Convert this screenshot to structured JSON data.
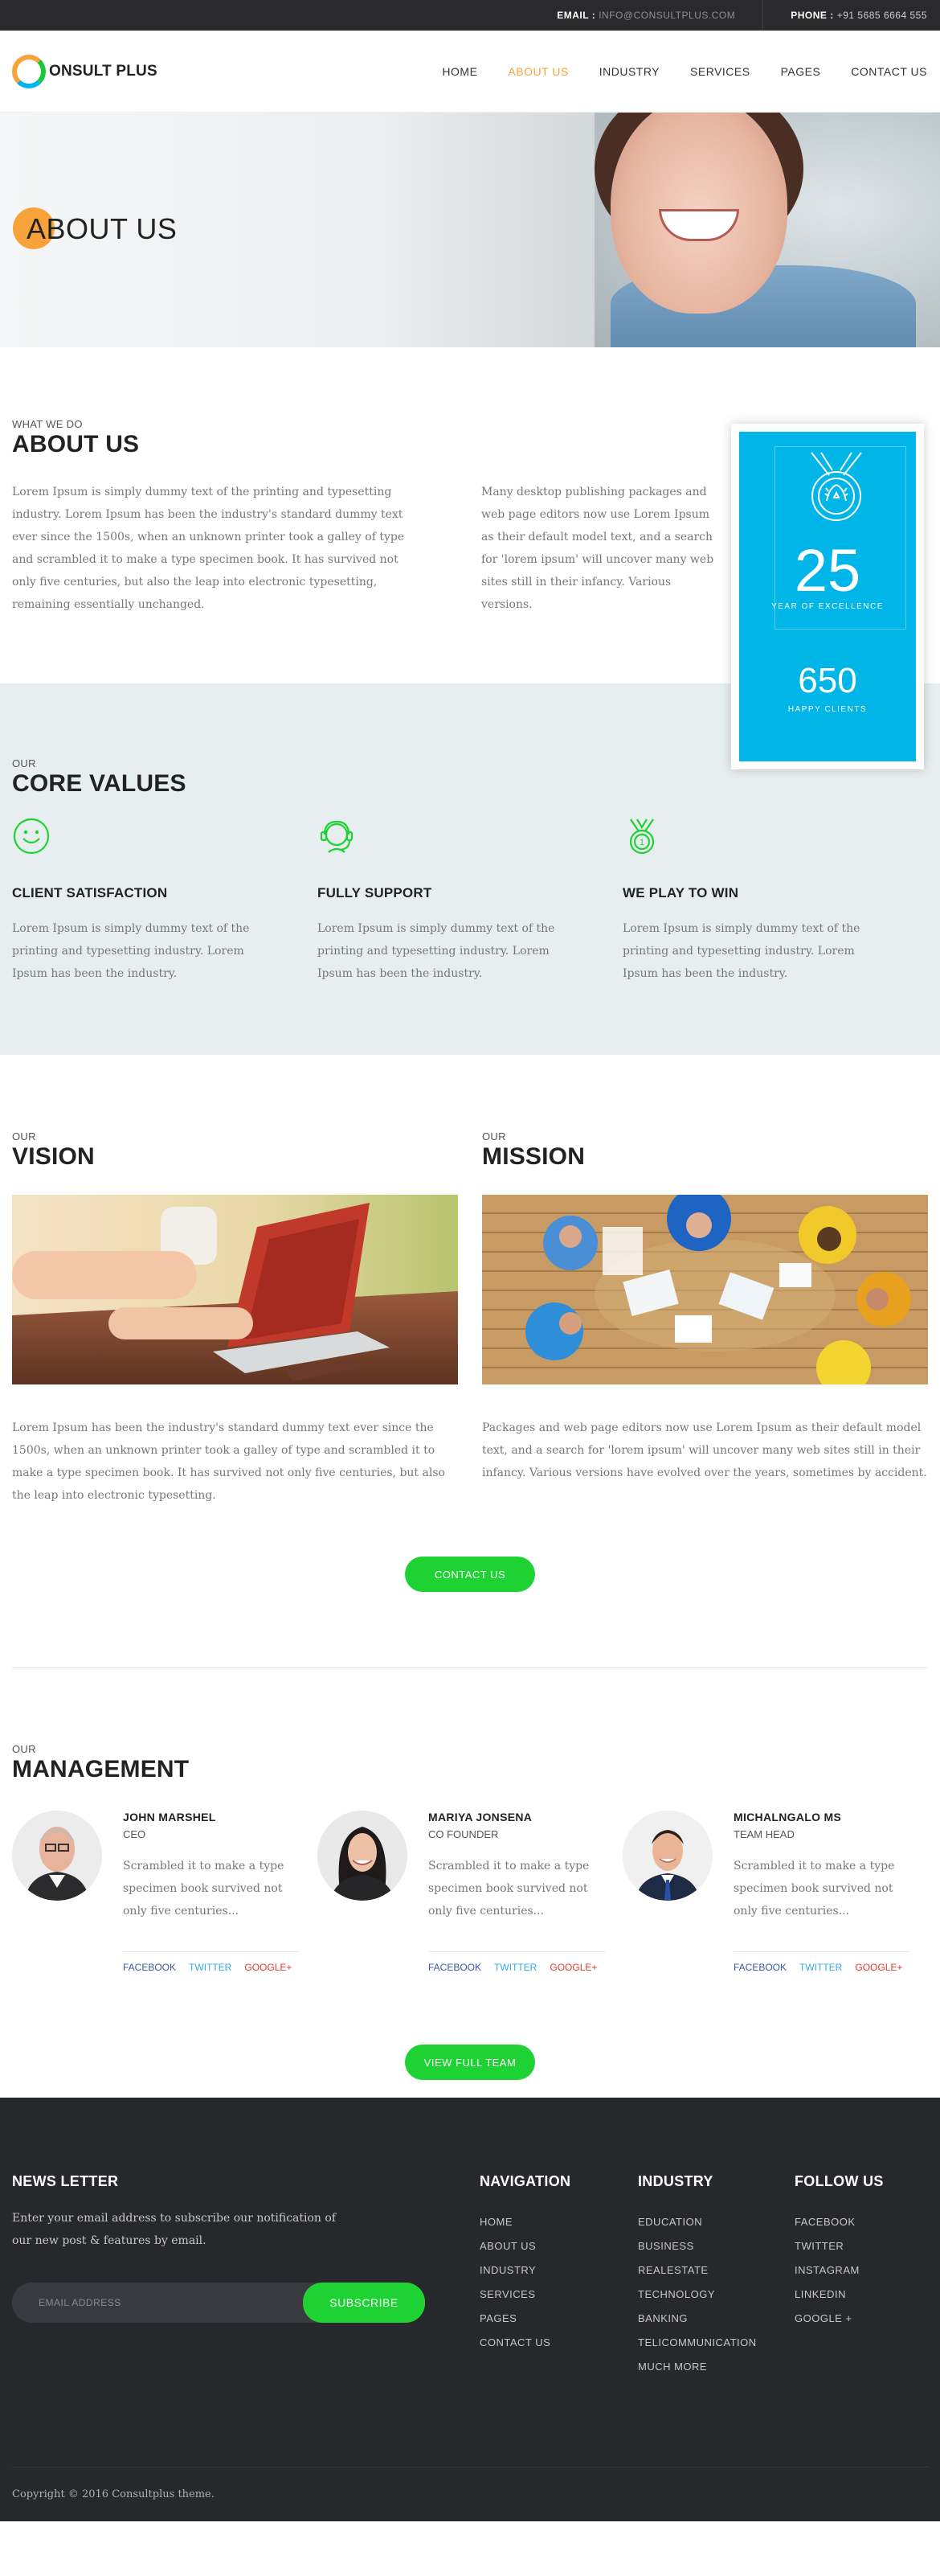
{
  "topbar": {
    "email_label": "EMAIL :",
    "email_value": "INFO@CONSULTPLUS.COM",
    "phone_label": "PHONE :",
    "phone_value": "+91 5685 6664 555"
  },
  "header": {
    "logo_text": "ONSULT PLUS",
    "nav": [
      {
        "label": "HOME"
      },
      {
        "label": "ABOUT US",
        "active": true
      },
      {
        "label": "INDUSTRY"
      },
      {
        "label": "SERVICES"
      },
      {
        "label": "PAGES"
      },
      {
        "label": "CONTACT US"
      }
    ],
    "accent_color": "#f7a23a"
  },
  "hero": {
    "title": "ABOUT US"
  },
  "about": {
    "eyebrow": "WHAT WE DO",
    "title": "ABOUT US",
    "col1": "Lorem Ipsum is simply dummy text of the printing and typesetting industry. Lorem Ipsum has been the industry's standard dummy text ever since the 1500s, when an unknown printer took a galley of type and scrambled it to make a type specimen book. It has survived not only five centuries, but also the leap into electronic typesetting, remaining essentially unchanged.",
    "col2": "Many desktop publishing packages and web page editors now use Lorem Ipsum as their default model text, and a search for 'lorem ipsum' will uncover many web sites still in their infancy. Various versions.",
    "stats": {
      "years_value": "25",
      "years_label": "YEAR OF EXCELLENCE",
      "clients_value": "650",
      "clients_label": "HAPPY CLIENTS",
      "card_color": "#00b5e8"
    }
  },
  "core": {
    "eyebrow": "OUR",
    "title": "CORE VALUES",
    "items": [
      {
        "icon": "smiley-icon",
        "title": "CLIENT SATISFACTION",
        "text": "Lorem Ipsum is simply dummy text of the printing and typesetting industry. Lorem Ipsum has been the industry."
      },
      {
        "icon": "support-headset-icon",
        "title": "FULLY SUPPORT",
        "text": "Lorem Ipsum is simply dummy text of the printing and typesetting industry. Lorem Ipsum has been the industry."
      },
      {
        "icon": "medal-icon",
        "title": "WE PLAY TO WIN",
        "text": "Lorem Ipsum is simply dummy text of the printing and typesetting industry. Lorem Ipsum has been the industry."
      }
    ],
    "icon_color": "#1fd233"
  },
  "vision": {
    "eyebrow": "OUR",
    "title": "VISION",
    "text": "Lorem Ipsum has been the industry's standard dummy text ever since the 1500s, when an unknown printer took a galley of type and scrambled it to make a type specimen book. It has survived not only five centuries, but also the leap into electronic typesetting."
  },
  "mission": {
    "eyebrow": "OUR",
    "title": "MISSION",
    "text": "Packages and web page editors now use Lorem Ipsum as their default model text, and a search for 'lorem ipsum' will uncover many web sites still in their infancy. Various versions have evolved over the years, sometimes by accident."
  },
  "contact_button": "CONTACT US",
  "management": {
    "eyebrow": "OUR",
    "title": "MANAGEMENT",
    "members": [
      {
        "name": "JOHN MARSHEL",
        "role": "CEO",
        "text": "Scrambled it to make a type specimen book survived not only five centuries..."
      },
      {
        "name": "MARIYA JONSENA",
        "role": "CO FOUNDER",
        "text": "Scrambled it to make a type specimen book survived not only five centuries..."
      },
      {
        "name": "MICHALNGALO MS",
        "role": "TEAM HEAD",
        "text": "Scrambled it to make a type specimen book survived not only five centuries..."
      }
    ],
    "social": {
      "facebook": "FACEBOOK",
      "twitter": "TWITTER",
      "google": "GOOGLE+"
    },
    "team_button": "VIEW FULL TEAM"
  },
  "footer": {
    "newsletter_title": "NEWS LETTER",
    "newsletter_text": "Enter your email address to subscribe our notification of our new post & features by email.",
    "email_placeholder": "EMAIL ADDRESS",
    "subscribe_label": "SUBSCRIBE",
    "navigation": {
      "title": "NAVIGATION",
      "items": [
        "HOME",
        "ABOUT US",
        "INDUSTRY",
        "SERVICES",
        "PAGES",
        "CONTACT US"
      ]
    },
    "industry": {
      "title": "INDUSTRY",
      "items": [
        "EDUCATION",
        "BUSINESS",
        "REALESTATE",
        "TECHNOLOGY",
        "BANKING",
        "TELICOMMUNICATION",
        "MUCH MORE"
      ]
    },
    "follow": {
      "title": "FOLLOW US",
      "items": [
        "FACEBOOK",
        "TWITTER",
        "INSTAGRAM",
        "LINKEDIN",
        "GOOGLE +"
      ]
    },
    "copyright": "Copyright © 2016 Consultplus theme."
  }
}
